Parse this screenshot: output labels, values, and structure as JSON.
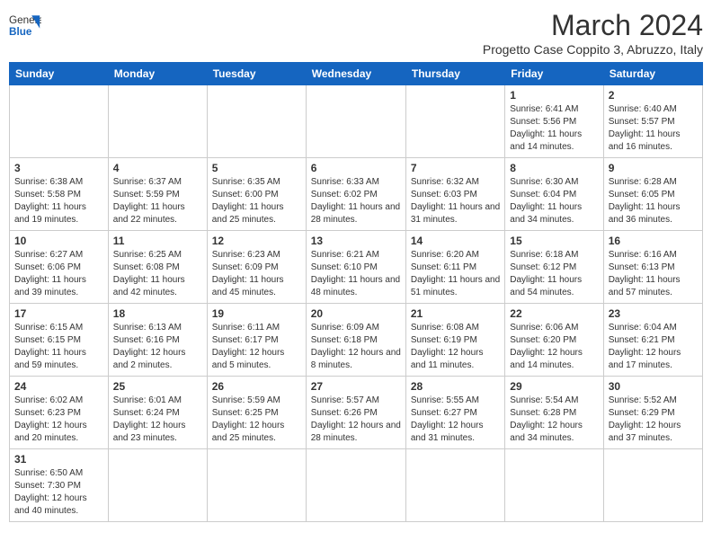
{
  "header": {
    "logo_general": "General",
    "logo_blue": "Blue",
    "month_title": "March 2024",
    "subtitle": "Progetto Case Coppito 3, Abruzzo, Italy"
  },
  "weekdays": [
    "Sunday",
    "Monday",
    "Tuesday",
    "Wednesday",
    "Thursday",
    "Friday",
    "Saturday"
  ],
  "weeks": [
    [
      {
        "day": "",
        "info": ""
      },
      {
        "day": "",
        "info": ""
      },
      {
        "day": "",
        "info": ""
      },
      {
        "day": "",
        "info": ""
      },
      {
        "day": "",
        "info": ""
      },
      {
        "day": "1",
        "info": "Sunrise: 6:41 AM\nSunset: 5:56 PM\nDaylight: 11 hours and 14 minutes."
      },
      {
        "day": "2",
        "info": "Sunrise: 6:40 AM\nSunset: 5:57 PM\nDaylight: 11 hours and 16 minutes."
      }
    ],
    [
      {
        "day": "3",
        "info": "Sunrise: 6:38 AM\nSunset: 5:58 PM\nDaylight: 11 hours and 19 minutes."
      },
      {
        "day": "4",
        "info": "Sunrise: 6:37 AM\nSunset: 5:59 PM\nDaylight: 11 hours and 22 minutes."
      },
      {
        "day": "5",
        "info": "Sunrise: 6:35 AM\nSunset: 6:00 PM\nDaylight: 11 hours and 25 minutes."
      },
      {
        "day": "6",
        "info": "Sunrise: 6:33 AM\nSunset: 6:02 PM\nDaylight: 11 hours and 28 minutes."
      },
      {
        "day": "7",
        "info": "Sunrise: 6:32 AM\nSunset: 6:03 PM\nDaylight: 11 hours and 31 minutes."
      },
      {
        "day": "8",
        "info": "Sunrise: 6:30 AM\nSunset: 6:04 PM\nDaylight: 11 hours and 34 minutes."
      },
      {
        "day": "9",
        "info": "Sunrise: 6:28 AM\nSunset: 6:05 PM\nDaylight: 11 hours and 36 minutes."
      }
    ],
    [
      {
        "day": "10",
        "info": "Sunrise: 6:27 AM\nSunset: 6:06 PM\nDaylight: 11 hours and 39 minutes."
      },
      {
        "day": "11",
        "info": "Sunrise: 6:25 AM\nSunset: 6:08 PM\nDaylight: 11 hours and 42 minutes."
      },
      {
        "day": "12",
        "info": "Sunrise: 6:23 AM\nSunset: 6:09 PM\nDaylight: 11 hours and 45 minutes."
      },
      {
        "day": "13",
        "info": "Sunrise: 6:21 AM\nSunset: 6:10 PM\nDaylight: 11 hours and 48 minutes."
      },
      {
        "day": "14",
        "info": "Sunrise: 6:20 AM\nSunset: 6:11 PM\nDaylight: 11 hours and 51 minutes."
      },
      {
        "day": "15",
        "info": "Sunrise: 6:18 AM\nSunset: 6:12 PM\nDaylight: 11 hours and 54 minutes."
      },
      {
        "day": "16",
        "info": "Sunrise: 6:16 AM\nSunset: 6:13 PM\nDaylight: 11 hours and 57 minutes."
      }
    ],
    [
      {
        "day": "17",
        "info": "Sunrise: 6:15 AM\nSunset: 6:15 PM\nDaylight: 11 hours and 59 minutes."
      },
      {
        "day": "18",
        "info": "Sunrise: 6:13 AM\nSunset: 6:16 PM\nDaylight: 12 hours and 2 minutes."
      },
      {
        "day": "19",
        "info": "Sunrise: 6:11 AM\nSunset: 6:17 PM\nDaylight: 12 hours and 5 minutes."
      },
      {
        "day": "20",
        "info": "Sunrise: 6:09 AM\nSunset: 6:18 PM\nDaylight: 12 hours and 8 minutes."
      },
      {
        "day": "21",
        "info": "Sunrise: 6:08 AM\nSunset: 6:19 PM\nDaylight: 12 hours and 11 minutes."
      },
      {
        "day": "22",
        "info": "Sunrise: 6:06 AM\nSunset: 6:20 PM\nDaylight: 12 hours and 14 minutes."
      },
      {
        "day": "23",
        "info": "Sunrise: 6:04 AM\nSunset: 6:21 PM\nDaylight: 12 hours and 17 minutes."
      }
    ],
    [
      {
        "day": "24",
        "info": "Sunrise: 6:02 AM\nSunset: 6:23 PM\nDaylight: 12 hours and 20 minutes."
      },
      {
        "day": "25",
        "info": "Sunrise: 6:01 AM\nSunset: 6:24 PM\nDaylight: 12 hours and 23 minutes."
      },
      {
        "day": "26",
        "info": "Sunrise: 5:59 AM\nSunset: 6:25 PM\nDaylight: 12 hours and 25 minutes."
      },
      {
        "day": "27",
        "info": "Sunrise: 5:57 AM\nSunset: 6:26 PM\nDaylight: 12 hours and 28 minutes."
      },
      {
        "day": "28",
        "info": "Sunrise: 5:55 AM\nSunset: 6:27 PM\nDaylight: 12 hours and 31 minutes."
      },
      {
        "day": "29",
        "info": "Sunrise: 5:54 AM\nSunset: 6:28 PM\nDaylight: 12 hours and 34 minutes."
      },
      {
        "day": "30",
        "info": "Sunrise: 5:52 AM\nSunset: 6:29 PM\nDaylight: 12 hours and 37 minutes."
      }
    ],
    [
      {
        "day": "31",
        "info": "Sunrise: 6:50 AM\nSunset: 7:30 PM\nDaylight: 12 hours and 40 minutes."
      },
      {
        "day": "",
        "info": ""
      },
      {
        "day": "",
        "info": ""
      },
      {
        "day": "",
        "info": ""
      },
      {
        "day": "",
        "info": ""
      },
      {
        "day": "",
        "info": ""
      },
      {
        "day": "",
        "info": ""
      }
    ]
  ]
}
